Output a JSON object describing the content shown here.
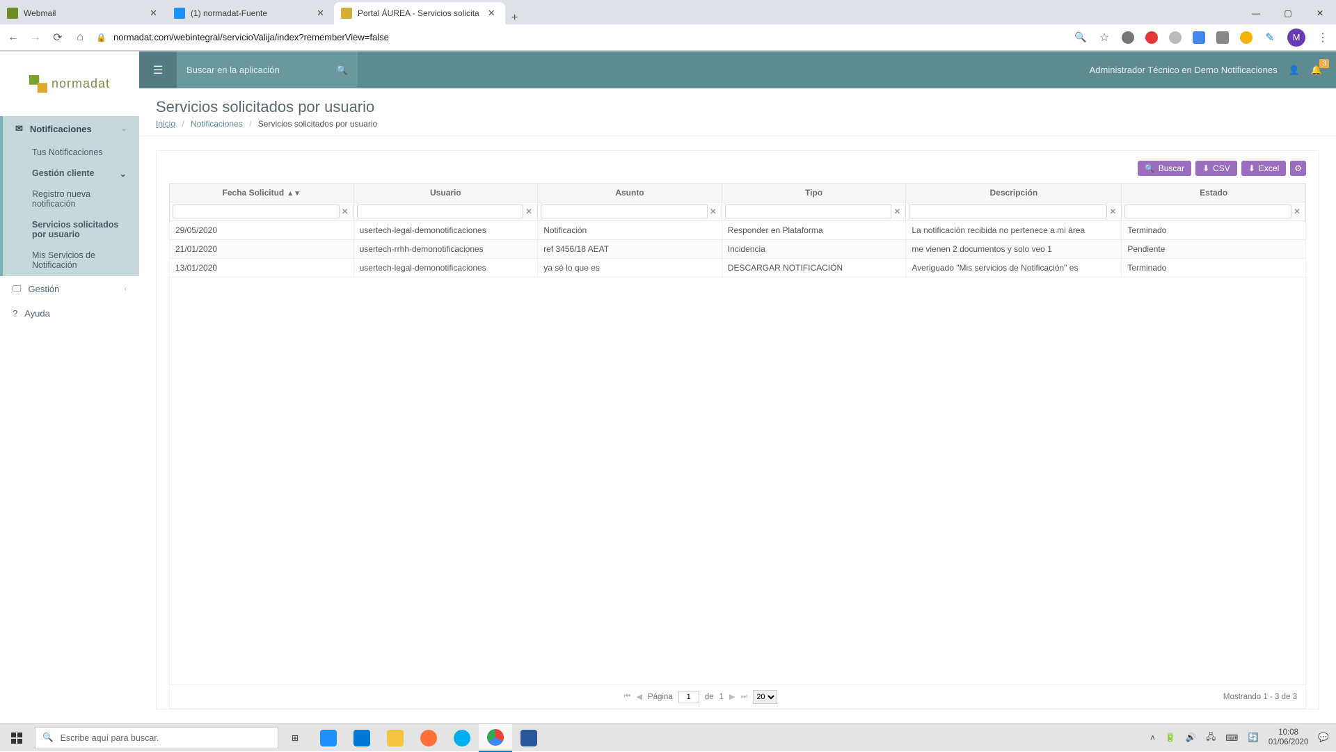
{
  "browser": {
    "tabs": [
      {
        "title": "Webmail"
      },
      {
        "title": "(1) normadat-Fuente"
      },
      {
        "title": "Portal ÁUREA - Servicios solicita"
      }
    ],
    "url": "normadat.com/webintegral/servicioValija/index?rememberView=false",
    "avatar_letter": "M"
  },
  "app": {
    "logo_text": "normadat",
    "search_placeholder": "Buscar en la aplicación",
    "user_label": "Administrador Técnico en Demo Notificaciones",
    "notif_badge": "3"
  },
  "sidebar": {
    "group_notif": "Notificaciones",
    "items_notif": [
      "Tus Notificaciones"
    ],
    "group_gestion_cli": "Gestión cliente",
    "items_gestion_cli": [
      "Registro nueva notificación",
      "Servicios solicitados por usuario",
      "Mis Servicios de Notificación"
    ],
    "group_gestion": "Gestión",
    "group_ayuda": "Ayuda"
  },
  "page": {
    "title": "Servicios solicitados por usuario",
    "crumb_home": "Inicio",
    "crumb_mid": "Notificaciones",
    "crumb_cur": "Servicios solicitados por usuario"
  },
  "toolbar": {
    "buscar": "Buscar",
    "csv": "CSV",
    "excel": "Excel"
  },
  "grid": {
    "cols": [
      "Fecha Solicitud",
      "Usuario",
      "Asunto",
      "Tipo",
      "Descripción",
      "Estado"
    ],
    "rows": [
      {
        "fecha": "29/05/2020",
        "usuario": "usertech-legal-demonotificaciones",
        "asunto": "Notificación",
        "tipo": "Responder en Plataforma",
        "desc": "La notificación recibida no pertenece a mi área",
        "estado": "Terminado"
      },
      {
        "fecha": "21/01/2020",
        "usuario": "usertech-rrhh-demonotificaciones",
        "asunto": "ref 3456/18 AEAT",
        "tipo": "Incidencia",
        "desc": "me vienen 2 documentos y solo veo 1",
        "estado": "Pendiente"
      },
      {
        "fecha": "13/01/2020",
        "usuario": "usertech-legal-demonotificaciones",
        "asunto": "ya sé lo que es",
        "tipo": "DESCARGAR NOTIFICACIÓN",
        "desc": "Averiguado \"Mis servicios de Notificación\" es",
        "estado": "Terminado"
      }
    ]
  },
  "pager": {
    "label_page": "Página",
    "label_of": "de",
    "page": "1",
    "total": "1",
    "size": "20",
    "showing": "Mostrando 1 - 3 de 3"
  },
  "taskbar": {
    "search_placeholder": "Escribe aquí para buscar.",
    "time": "10:08",
    "date": "01/06/2020"
  }
}
